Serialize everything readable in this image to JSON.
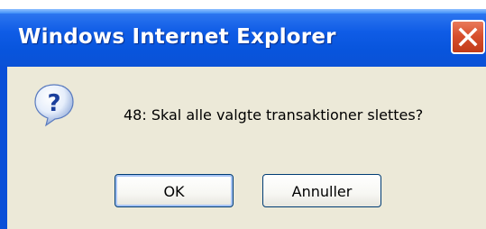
{
  "window": {
    "title": "Windows Internet Explorer",
    "close_icon": "close-icon"
  },
  "dialog": {
    "icon": "question-icon",
    "message": "48: Skal alle valgte transaktioner slettes?",
    "buttons": {
      "ok_label": "OK",
      "cancel_label": "Annuller"
    }
  },
  "colors": {
    "titlebar": "#0855dd",
    "client": "#ece9d8",
    "close_button": "#d8502e"
  }
}
